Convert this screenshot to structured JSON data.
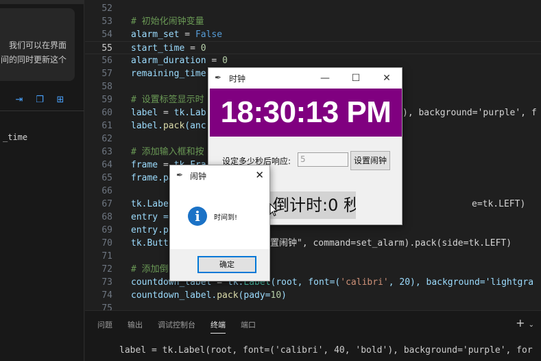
{
  "chat": {
    "line1": "我们可以在界面",
    "line2": "间的同时更新这个",
    "code": "_time"
  },
  "editor": {
    "lines": [
      {
        "n": "52",
        "text": ""
      },
      {
        "n": "53",
        "text": "# 初始化闹钟变量"
      },
      {
        "n": "54",
        "text": "alarm_set = False"
      },
      {
        "n": "55",
        "text": "start_time = 0"
      },
      {
        "n": "56",
        "text": "alarm_duration = 0"
      },
      {
        "n": "57",
        "text": "remaining_time"
      },
      {
        "n": "58",
        "text": ""
      },
      {
        "n": "59",
        "text": "# 设置标签显示时"
      },
      {
        "n": "60",
        "text": "label = tk.Lab"
      },
      {
        "n": "61",
        "text": "label.pack(anc"
      },
      {
        "n": "62",
        "text": ""
      },
      {
        "n": "63",
        "text": "# 添加输入框和按"
      },
      {
        "n": "64",
        "text": "frame = tk.Fra"
      },
      {
        "n": "65",
        "text": "frame.pa"
      },
      {
        "n": "66",
        "text": ""
      },
      {
        "n": "67",
        "text": "tk.Labe"
      },
      {
        "n": "68",
        "text": "entry ="
      },
      {
        "n": "69",
        "text": "entry.p"
      },
      {
        "n": "70",
        "text": "tk.Butt"
      },
      {
        "n": "71",
        "text": ""
      },
      {
        "n": "72",
        "text": "# 添加倒"
      },
      {
        "n": "73",
        "text": "countdown_label = tk.Label(root, font=('calibri', 20), background='lightgra"
      },
      {
        "n": "74",
        "text": "countdown_label.pack(pady=10)"
      },
      {
        "n": "75",
        "text": ""
      }
    ],
    "line60_tail": "), background='purple', f",
    "line67_tail": "e=tk.LEFT)",
    "line70_tail": "置闹钟\", command=set_alarm).pack(side=tk.LEFT)"
  },
  "panel": {
    "tabs": [
      "问题",
      "输出",
      "调试控制台",
      "终端",
      "端口"
    ],
    "selected_tab": "终端",
    "add_icon": "+",
    "terminal_line": "label = tk.Label(root, font=('calibri', 40, 'bold'), background='purple', for"
  },
  "clock_window": {
    "title": "时钟",
    "time": "18:30:13 PM",
    "prompt_label": "设定多少秒后响应:",
    "seconds_value": "5",
    "set_button": "设置闹钟",
    "countdown": "倒计时:0 秒",
    "face_color": "#800080"
  },
  "dialog": {
    "title": "闹钟",
    "message": "时间到!",
    "ok_button": "确定",
    "icon": "information-icon"
  }
}
